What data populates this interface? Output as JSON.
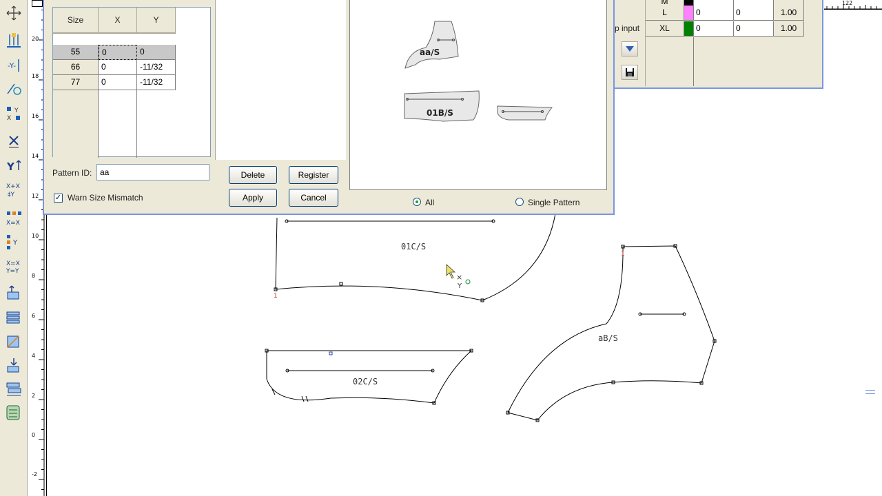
{
  "toolbar": {
    "tools": [
      "move-point-icon",
      "align-points-icon",
      "y-align-icon",
      "rotate-point-icon",
      "xy-distribute-icon",
      "delete-point-icon",
      "y-move-icon",
      "swap-xy-icon",
      "x-equal-icon",
      "y-equal-icon",
      "xy-equal-icon",
      "grade-table-icon",
      "copy-grade-icon",
      "curve-grade-icon",
      "flip-grade-icon",
      "stack-grade-icon",
      "layer-grade-icon"
    ]
  },
  "ruler": {
    "labels": [
      "20",
      "18",
      "16",
      "14",
      "12",
      "10",
      "8",
      "6",
      "4",
      "2",
      "0",
      "-2"
    ],
    "top_label": "122"
  },
  "dialog": {
    "table": {
      "headers": [
        "Size",
        "X",
        "Y"
      ],
      "rows": [
        {
          "size": "55",
          "x": "0",
          "y": "0"
        },
        {
          "size": "66",
          "x": "0",
          "y": "-11/32"
        },
        {
          "size": "77",
          "x": "0",
          "y": "-11/32"
        }
      ]
    },
    "pattern_id_label": "Pattern ID:",
    "pattern_id_value": "aa",
    "warn_label": "Warn Size Mismatch",
    "warn_checked": "✓",
    "buttons": {
      "delete": "Delete",
      "register": "Register",
      "apply": "Apply",
      "cancel": "Cancel"
    },
    "preview": {
      "pieces": [
        "aa/S",
        "01B/S"
      ],
      "radio_all": "All",
      "radio_single": "Single Pattern"
    }
  },
  "right_panel": {
    "input_label": "p input",
    "grade_rows": [
      {
        "label": "M",
        "color": "#000000",
        "x": "",
        "y": "",
        "scale": ""
      },
      {
        "label": "L",
        "color": "#ff80ff",
        "x": "0",
        "y": "0",
        "scale": "1.00"
      },
      {
        "label": "XL",
        "color": "#008000",
        "x": "0",
        "y": "0",
        "scale": "1.00"
      }
    ]
  },
  "canvas": {
    "pieces": [
      "01C/S",
      "02C/S",
      "aB/S"
    ],
    "marker": "1"
  }
}
